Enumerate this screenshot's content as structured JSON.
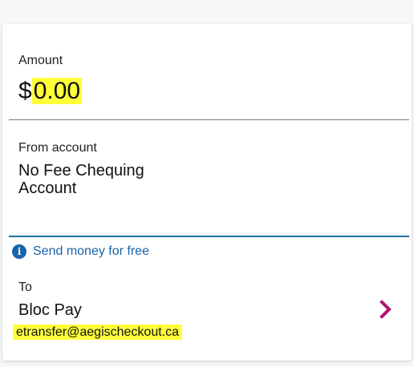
{
  "amount": {
    "label": "Amount",
    "currency": "$",
    "value": "0.00"
  },
  "from_account": {
    "label": "From account",
    "value": "No Fee Chequing Account"
  },
  "info": {
    "icon": "info-icon",
    "text": "Send money for free"
  },
  "to": {
    "label": "To",
    "name": "Bloc Pay",
    "email": "etransfer@aegischeckout.ca"
  },
  "colors": {
    "accent": "#1565a8",
    "chevron": "#b0146e",
    "highlight": "#ffff3a"
  },
  "icons": {
    "chevron": "chevron-right-icon"
  }
}
